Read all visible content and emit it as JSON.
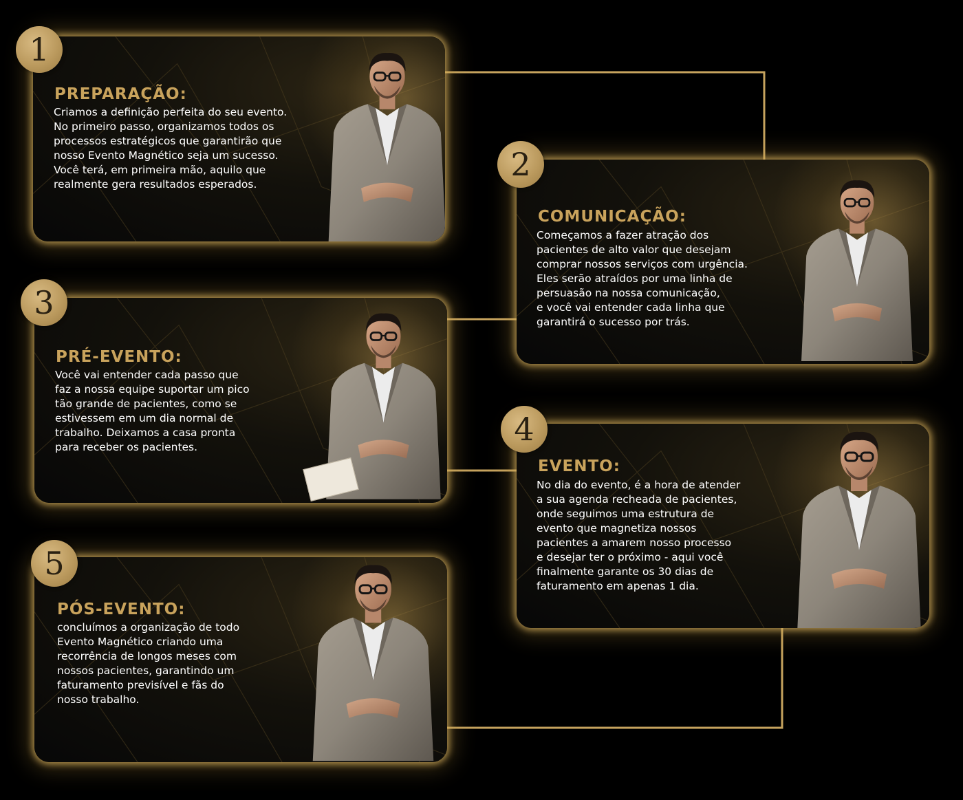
{
  "colors": {
    "background": "#000000",
    "gold": "#c9a35c",
    "badge": "#bb9a5e",
    "text": "#ffffff"
  },
  "steps": [
    {
      "number": "1",
      "title": "PREPARAÇÃO:",
      "text": "Criamos a definição perfeita do seu evento.\nNo primeiro passo, organizamos todos os\nprocessos estratégicos que garantirão que\nnosso Evento Magnético seja um sucesso.\nVocê terá, em primeira mão, aquilo que\nrealmente gera resultados esperados.",
      "image": "man-in-gray-suit-standing-photo"
    },
    {
      "number": "2",
      "title": "COMUNICAÇÃO:",
      "text": "Começamos a fazer atração dos\npacientes de alto valor que desejam\ncomprar nossos serviços com urgência.\nEles serão atraídos por uma linha de\npersuasão na nossa comunicação,\ne você vai entender cada linha que\ngarantirá o sucesso por trás.",
      "image": "man-in-gray-suit-seated-photo"
    },
    {
      "number": "3",
      "title": "PRÉ-EVENTO:",
      "text": "Você vai entender cada passo que\nfaz a nossa equipe suportar um pico\ntão grande de pacientes, como se\nestivessem em um dia normal de\ntrabalho. Deixamos a casa pronta\npara receber os pacientes.",
      "image": "man-in-gray-suit-holding-book-photo"
    },
    {
      "number": "4",
      "title": "EVENTO:",
      "text": "No dia do evento, é a hora de atender\na sua agenda recheada de pacientes,\nonde seguimos uma estrutura de\nevento que magnetiza nossos\npacientes a amarem nosso processo\ne desejar ter o próximo - aqui você\nfinalmente garante os 30 dias de\nfaturamento em apenas 1 dia.",
      "image": "man-in-gray-suit-seated-hands-on-knees-photo"
    },
    {
      "number": "5",
      "title": "PÓS-EVENTO:",
      "text": "concluímos a organização de todo\nEvento Magnético criando uma\nrecorrência de longos meses com\nnossos pacientes, garantindo um\nfaturamento previsível e fãs do\nnosso trabalho.",
      "image": "man-in-gray-suit-seated-hands-clasped-photo"
    }
  ]
}
